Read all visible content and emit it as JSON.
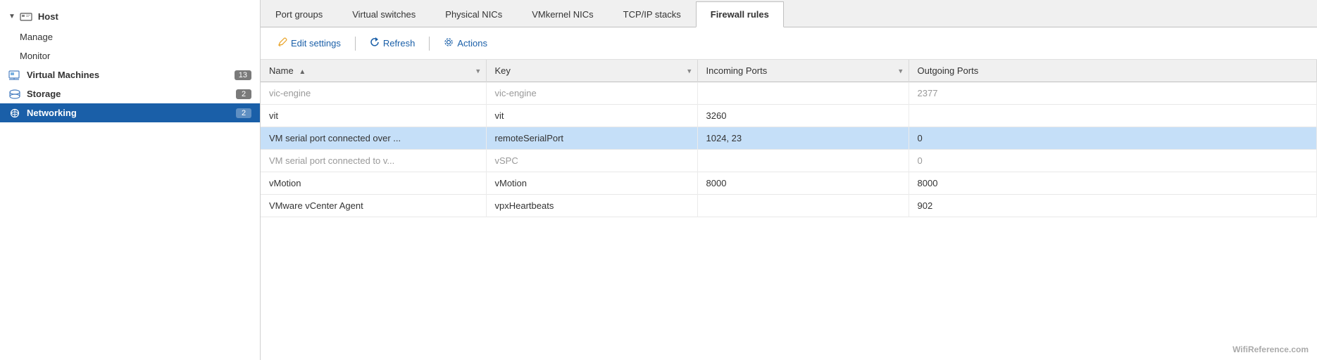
{
  "sidebar": {
    "host": {
      "label": "Host",
      "chevron": "▼"
    },
    "items": [
      {
        "id": "manage",
        "label": "Manage",
        "indent": true,
        "badge": null,
        "active": false
      },
      {
        "id": "monitor",
        "label": "Monitor",
        "indent": true,
        "badge": null,
        "active": false
      },
      {
        "id": "virtual-machines",
        "label": "Virtual Machines",
        "indent": false,
        "badge": "13",
        "active": false,
        "bold": true
      },
      {
        "id": "storage",
        "label": "Storage",
        "indent": false,
        "badge": "2",
        "active": false,
        "bold": true
      },
      {
        "id": "networking",
        "label": "Networking",
        "indent": false,
        "badge": "2",
        "active": true,
        "bold": true
      }
    ]
  },
  "tabs": [
    {
      "id": "port-groups",
      "label": "Port groups",
      "active": false
    },
    {
      "id": "virtual-switches",
      "label": "Virtual switches",
      "active": false
    },
    {
      "id": "physical-nics",
      "label": "Physical NICs",
      "active": false
    },
    {
      "id": "vmkernel-nics",
      "label": "VMkernel NICs",
      "active": false
    },
    {
      "id": "tcpip-stacks",
      "label": "TCP/IP stacks",
      "active": false
    },
    {
      "id": "firewall-rules",
      "label": "Firewall rules",
      "active": true
    }
  ],
  "toolbar": {
    "edit_settings_label": "Edit settings",
    "refresh_label": "Refresh",
    "actions_label": "Actions"
  },
  "table": {
    "columns": [
      {
        "id": "name",
        "label": "Name",
        "sort": "▲",
        "filter": true
      },
      {
        "id": "key",
        "label": "Key",
        "sort": "",
        "filter": true
      },
      {
        "id": "incoming",
        "label": "Incoming Ports",
        "sort": "",
        "filter": true
      },
      {
        "id": "outgoing",
        "label": "Outgoing Ports",
        "sort": "",
        "filter": false
      }
    ],
    "rows": [
      {
        "id": 0,
        "name": "vic-engine",
        "key": "vic-engine",
        "incoming": "",
        "outgoing": "2377",
        "dim": true,
        "selected": false
      },
      {
        "id": 1,
        "name": "vit",
        "key": "vit",
        "incoming": "3260",
        "outgoing": "",
        "dim": false,
        "selected": false
      },
      {
        "id": 2,
        "name": "VM serial port connected over ...",
        "key": "remoteSerialPort",
        "incoming": "1024, 23",
        "outgoing": "0",
        "dim": false,
        "selected": true
      },
      {
        "id": 3,
        "name": "VM serial port connected to v...",
        "key": "vSPC",
        "incoming": "",
        "outgoing": "0",
        "dim": true,
        "selected": false
      },
      {
        "id": 4,
        "name": "vMotion",
        "key": "vMotion",
        "incoming": "8000",
        "outgoing": "8000",
        "dim": false,
        "selected": false
      },
      {
        "id": 5,
        "name": "VMware vCenter Agent",
        "key": "vpxHeartbeats",
        "incoming": "",
        "outgoing": "902",
        "dim": false,
        "selected": false
      }
    ]
  },
  "watermark": "WifiReference.com"
}
